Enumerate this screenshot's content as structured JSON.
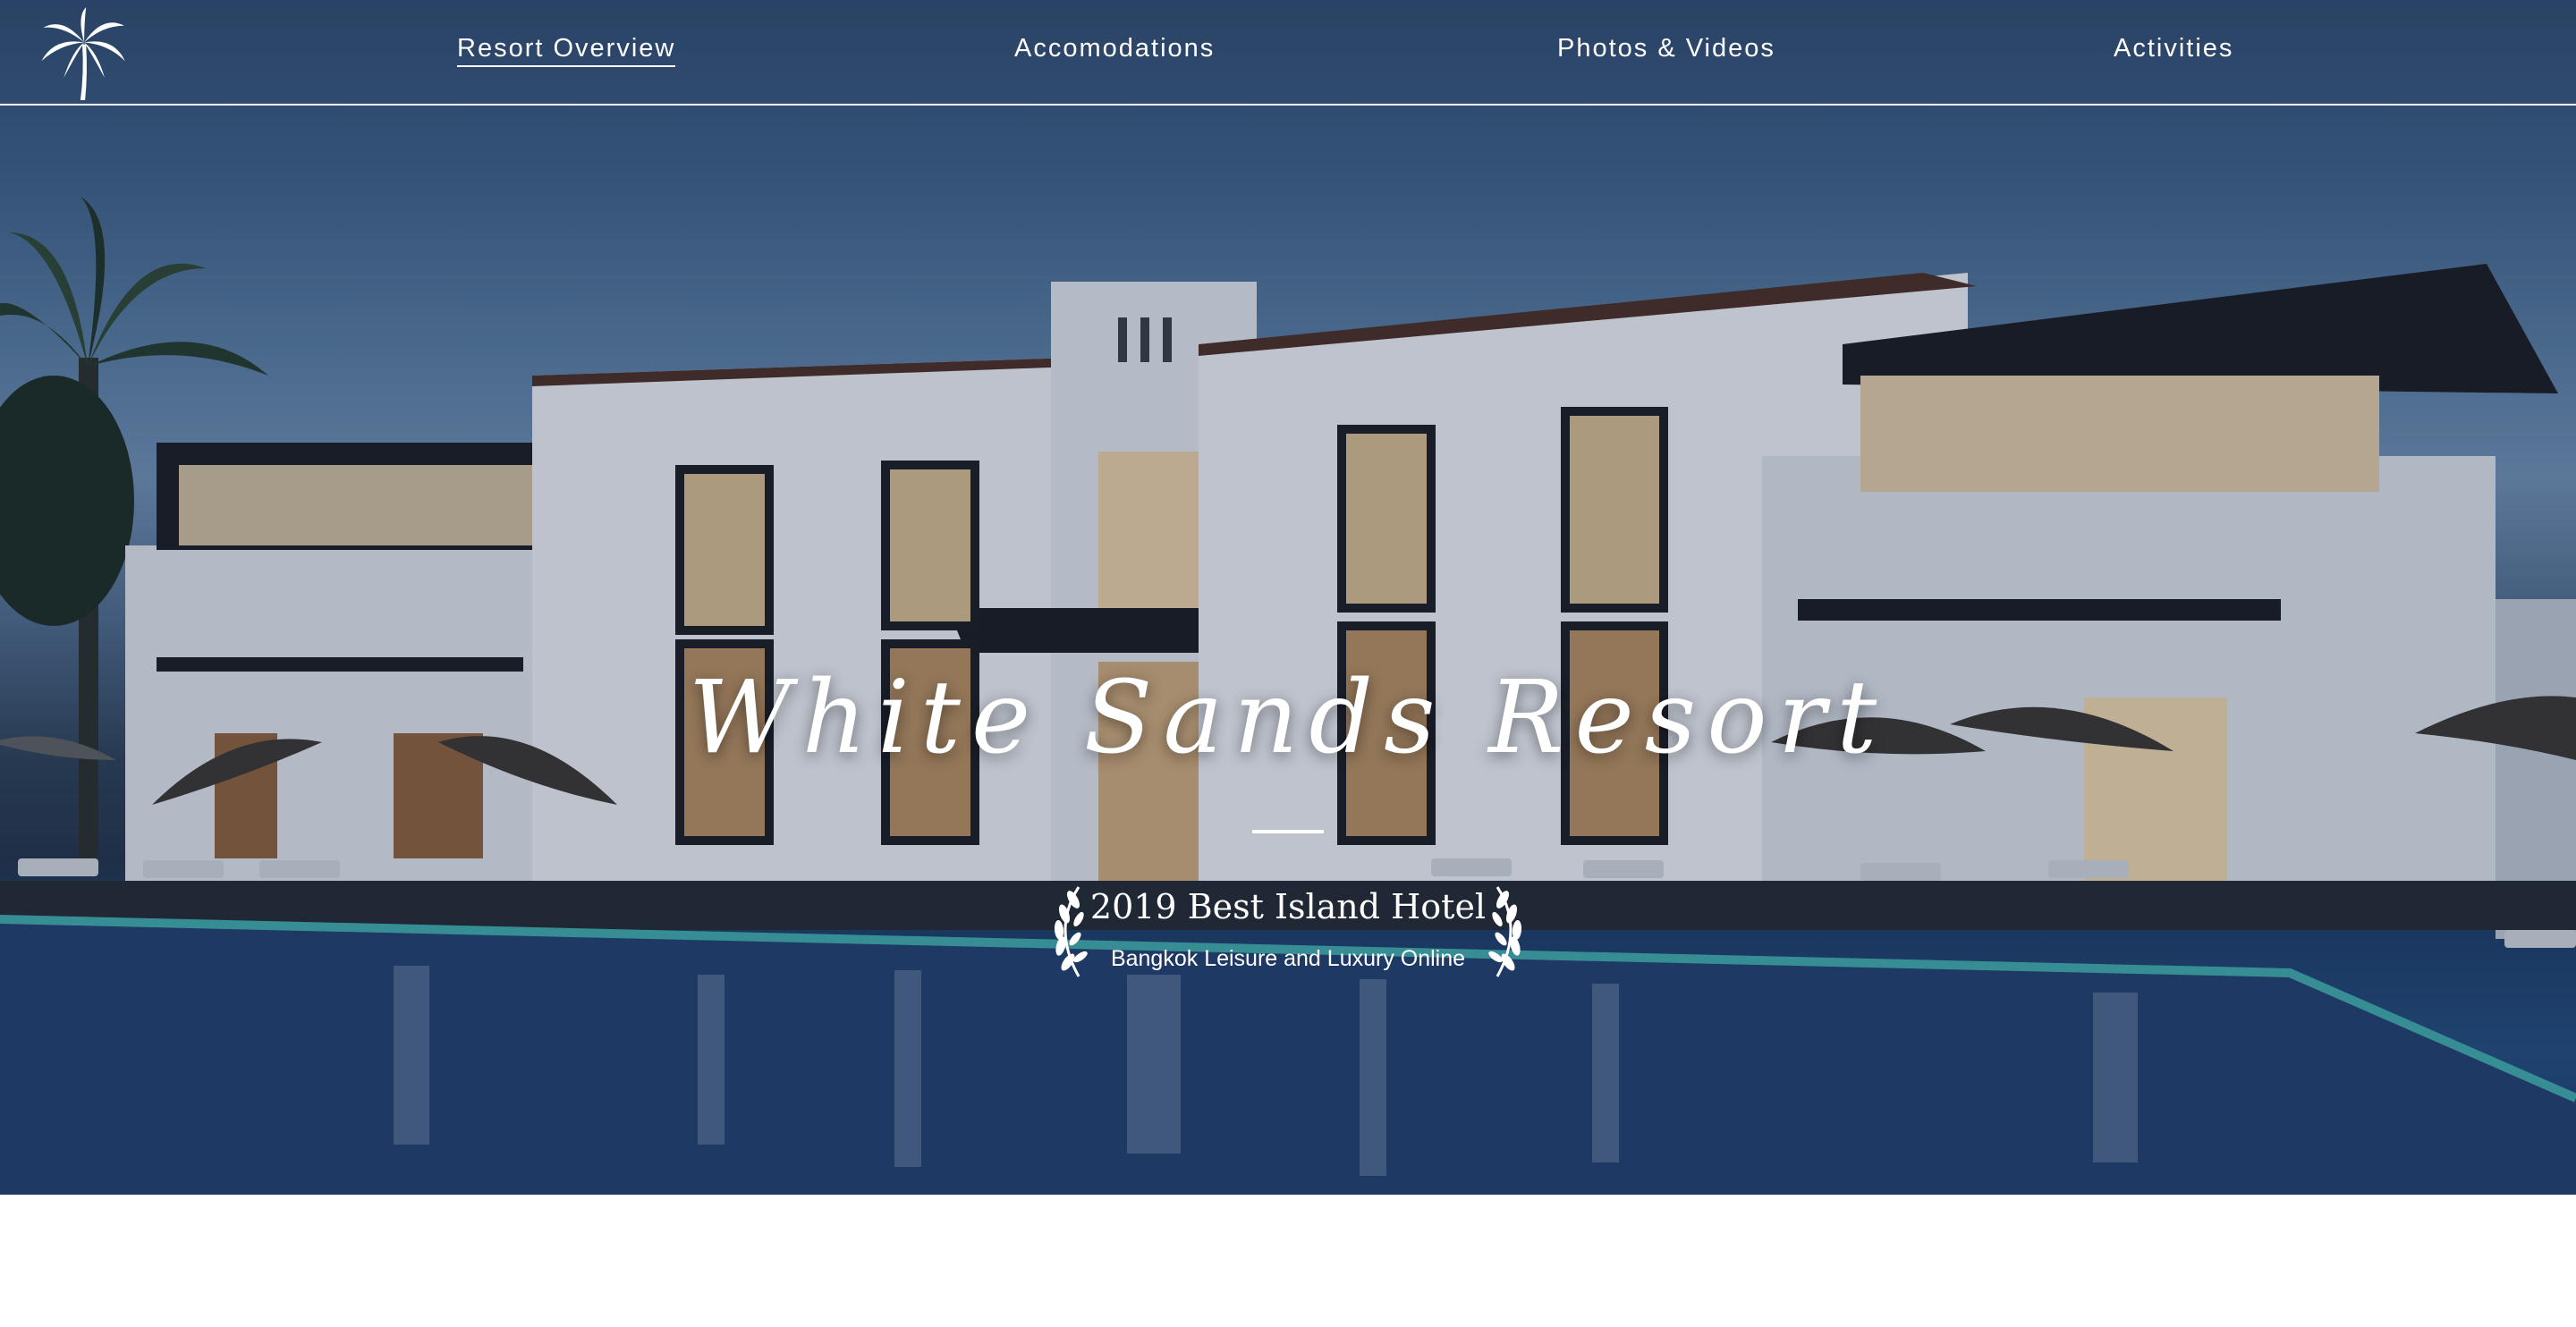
{
  "nav": {
    "logo_icon": "palm-tree-icon",
    "links": [
      {
        "label": "Resort Overview",
        "active": true
      },
      {
        "label": "Accomodations",
        "active": false
      },
      {
        "label": "Photos & Videos",
        "active": false
      },
      {
        "label": "Activities",
        "active": false
      }
    ]
  },
  "hero": {
    "title": "White Sands Resort",
    "award_title": "2019 Best Island Hotel",
    "award_subtitle": "Bangkok Leisure and Luxury Online",
    "award_icon": "laurel-wreath-icon"
  },
  "colors": {
    "nav_text": "#ffffff",
    "sky": "#3c5c84",
    "pool": "#234b7c",
    "building": "#dfe3ea",
    "page_background": "#ffffff"
  }
}
